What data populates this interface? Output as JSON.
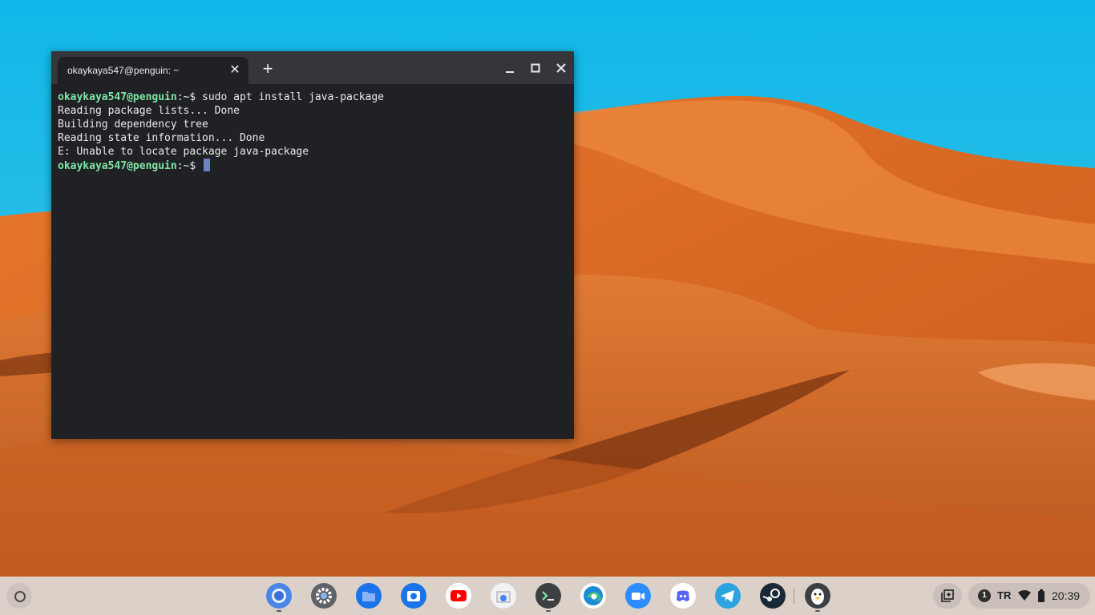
{
  "window": {
    "tab_title": "okaykaya547@penguin: ~",
    "tab_close_glyph": "✕",
    "new_tab_glyph": "+"
  },
  "terminal": {
    "prompt_user": "okaykaya547@penguin",
    "prompt_path": ":~$ ",
    "command": "sudo apt install java-package",
    "output": [
      "Reading package lists... Done",
      "Building dependency tree",
      "Reading state information... Done",
      "E: Unable to locate package java-package"
    ]
  },
  "shelf": {
    "apps": [
      {
        "name": "chrome-icon",
        "running": true
      },
      {
        "name": "settings-icon",
        "running": false
      },
      {
        "name": "files-icon",
        "running": false
      },
      {
        "name": "camera-icon",
        "running": false
      },
      {
        "name": "youtube-icon",
        "running": false
      },
      {
        "name": "web-store-icon",
        "running": false
      },
      {
        "name": "terminal-icon",
        "running": true
      },
      {
        "name": "edge-icon",
        "running": false
      },
      {
        "name": "zoom-icon",
        "running": false
      },
      {
        "name": "discord-icon",
        "running": false
      },
      {
        "name": "telegram-icon",
        "running": false
      },
      {
        "name": "steam-icon",
        "running": false
      },
      {
        "name": "penguin-icon",
        "running": true
      }
    ]
  },
  "tray": {
    "notification_count": "1",
    "ime": "TR",
    "time": "20:39"
  },
  "colors": {
    "sky": "#23b9e6",
    "sand": "#d9702a",
    "terminal_bg": "#202124",
    "titlebar": "#35363a",
    "prompt_user": "#7ee7a5",
    "cursor": "#6d84c4"
  }
}
